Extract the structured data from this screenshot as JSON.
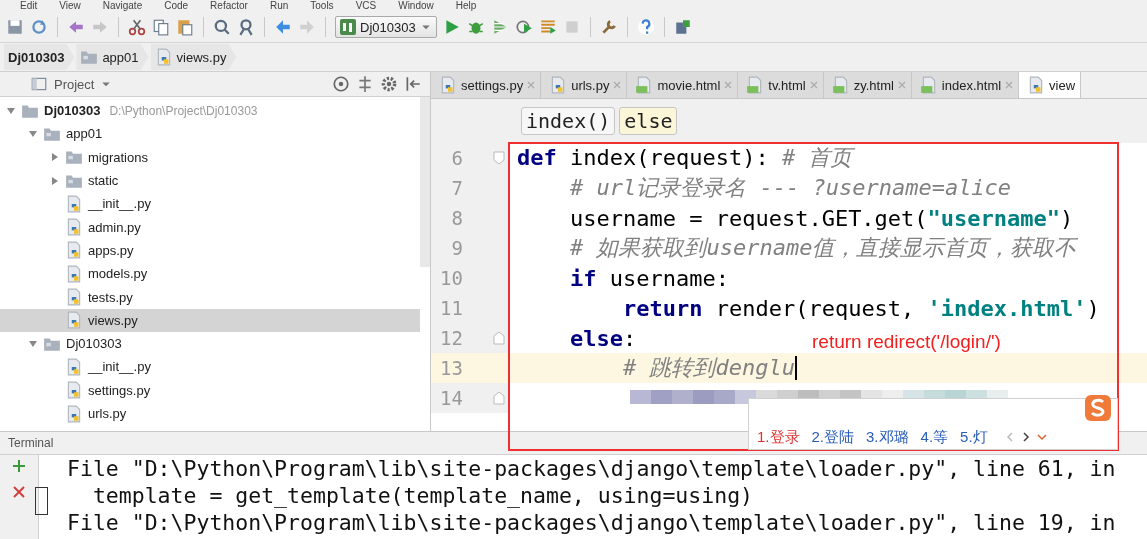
{
  "menu_bar": [
    "Edit",
    "View",
    "Navigate",
    "Code",
    "Refactor",
    "Run",
    "Tools",
    "VCS",
    "Window",
    "Help"
  ],
  "toolbar": {
    "run_config": "Dj010303"
  },
  "breadcrumbs": [
    {
      "label": "Dj010303",
      "kind": "project"
    },
    {
      "label": "app01",
      "kind": "folder"
    },
    {
      "label": "views.py",
      "kind": "python"
    }
  ],
  "project_panel": {
    "title": "Project",
    "tree": [
      {
        "label": "Dj010303",
        "kind": "root",
        "path": "D:\\Python\\Project\\Dj010303",
        "expanded": true,
        "selected": false,
        "children": [
          {
            "label": "app01",
            "kind": "folder",
            "expanded": true,
            "selected": false,
            "children": [
              {
                "label": "migrations",
                "kind": "folder",
                "expanded": false,
                "selected": false
              },
              {
                "label": "static",
                "kind": "folder",
                "expanded": false,
                "selected": false
              },
              {
                "label": "__init__.py",
                "kind": "python",
                "selected": false
              },
              {
                "label": "admin.py",
                "kind": "python",
                "selected": false
              },
              {
                "label": "apps.py",
                "kind": "python",
                "selected": false
              },
              {
                "label": "models.py",
                "kind": "python",
                "selected": false
              },
              {
                "label": "tests.py",
                "kind": "python",
                "selected": false
              },
              {
                "label": "views.py",
                "kind": "python",
                "selected": true
              }
            ]
          },
          {
            "label": "Dj010303",
            "kind": "folder",
            "expanded": true,
            "selected": false,
            "children": [
              {
                "label": "__init__.py",
                "kind": "python",
                "selected": false
              },
              {
                "label": "settings.py",
                "kind": "python",
                "selected": false
              },
              {
                "label": "urls.py",
                "kind": "python",
                "selected": false
              }
            ]
          }
        ]
      }
    ]
  },
  "editor_tabs": [
    {
      "label": "settings.py",
      "kind": "python",
      "selected": false
    },
    {
      "label": "urls.py",
      "kind": "python",
      "selected": false
    },
    {
      "label": "movie.html",
      "kind": "html",
      "selected": false
    },
    {
      "label": "tv.html",
      "kind": "html",
      "selected": false
    },
    {
      "label": "zy.html",
      "kind": "html",
      "selected": false
    },
    {
      "label": "index.html",
      "kind": "html",
      "selected": false
    },
    {
      "label": "view",
      "kind": "python",
      "selected": true
    }
  ],
  "code_breadcrumbs": [
    {
      "label": "index()",
      "selected": false
    },
    {
      "label": "else",
      "selected": true
    }
  ],
  "code_lines": [
    {
      "number": "6",
      "current": false,
      "tokens": [
        {
          "text": "def",
          "kind": "keyword"
        },
        {
          "text": " index(request): ",
          "kind": "plain"
        },
        {
          "text": "# 首页",
          "kind": "comment"
        }
      ]
    },
    {
      "number": "7",
      "current": false,
      "tokens": [
        {
          "text": "    # url记录登录名 --- ?username=alice",
          "kind": "comment"
        }
      ]
    },
    {
      "number": "8",
      "current": false,
      "tokens": [
        {
          "text": "    username = request.GET.get(",
          "kind": "plain"
        },
        {
          "text": "\"username\"",
          "kind": "string"
        },
        {
          "text": ")",
          "kind": "plain"
        }
      ]
    },
    {
      "number": "9",
      "current": false,
      "tokens": [
        {
          "text": "    # 如果获取到username值，直接显示首页，获取不",
          "kind": "comment"
        }
      ]
    },
    {
      "number": "10",
      "current": false,
      "tokens": [
        {
          "text": "    if",
          "kind": "keyword"
        },
        {
          "text": " username:",
          "kind": "plain"
        }
      ]
    },
    {
      "number": "11",
      "current": false,
      "tokens": [
        {
          "text": "        return",
          "kind": "keyword"
        },
        {
          "text": " render(request, ",
          "kind": "plain"
        },
        {
          "text": "'index.html'",
          "kind": "string"
        },
        {
          "text": ")",
          "kind": "plain"
        }
      ]
    },
    {
      "number": "12",
      "current": false,
      "tokens": [
        {
          "text": "    else",
          "kind": "keyword"
        },
        {
          "text": ":",
          "kind": "plain"
        }
      ]
    },
    {
      "number": "13",
      "current": true,
      "tokens": [
        {
          "text": "        # 跳转到denglu",
          "kind": "comment"
        }
      ]
    },
    {
      "number": "14",
      "current": false
    }
  ],
  "annotation": {
    "text": "return redirect('/login/')"
  },
  "ime_popup": {
    "candidates": [
      {
        "label": "1.登录",
        "selected": true
      },
      {
        "label": "2.登陆",
        "selected": false
      },
      {
        "label": "3.邓璐",
        "selected": false
      },
      {
        "label": "4.等",
        "selected": false
      },
      {
        "label": "5.灯",
        "selected": false
      }
    ]
  },
  "terminal": {
    "title": "Terminal",
    "lines": [
      "File \"D:\\Python\\Program\\lib\\site-packages\\django\\template\\loader.py\", line 61, in",
      "  template = get_template(template_name, using=using)",
      "File \"D:\\Python\\Program\\lib\\site-packages\\django\\template\\loader.py\", line 19, in"
    ]
  }
}
